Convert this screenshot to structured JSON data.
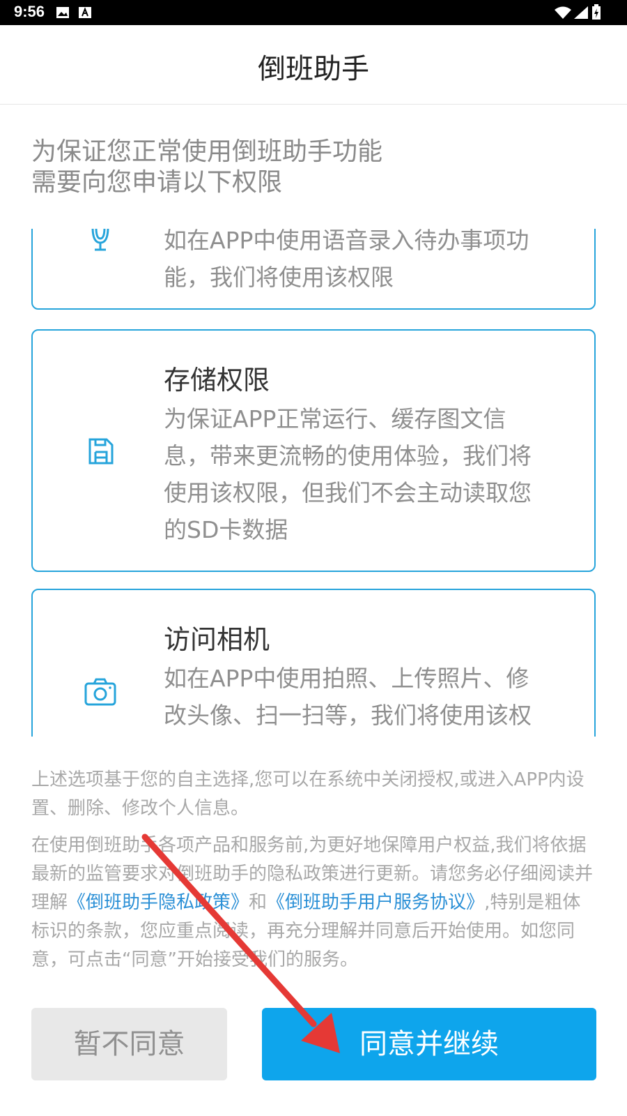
{
  "status_bar": {
    "time": "9:56"
  },
  "header": {
    "title": "倒班助手"
  },
  "intro": {
    "line1": "为保证您正常使用倒班助手功能",
    "line2": "需要向您申请以下权限"
  },
  "permissions": [
    {
      "icon": "microphone-icon",
      "title": "",
      "desc_line1": "如在APP中使用语音录入待办事项功",
      "desc_line2": "能，我们将使用该权限"
    },
    {
      "icon": "storage-icon",
      "title": "存储权限",
      "desc_line1": "为保证APP正常运行、缓存图文信",
      "desc_line2": "息，带来更流畅的使用体验，我们将",
      "desc_line3": "使用该权限，但我们不会主动读取您",
      "desc_line4": "的SD卡数据"
    },
    {
      "icon": "camera-icon",
      "title": "访问相机",
      "desc_line1": "如在APP中使用拍照、上传照片、修",
      "desc_line2": "改头像、扫一扫等，我们将使用该权"
    }
  ],
  "notice": {
    "para1": "上述选项基于您的自主选择,您可以在系统中关闭授权,或进入APP内设置、删除、修改个人信息。",
    "para2_before": "在使用倒班助手各项产品和服务前,为更好地保障用户权益,我们将依据最新的监管要求对倒班助手的隐私政策进行更新。请您务必仔细阅读并理解",
    "privacy_link": "《倒班助手隐私政策》",
    "and": "和",
    "service_link": "《倒班助手用户服务协议》",
    "para2_after": ",特别是粗体标识的条款，您应重点阅读，再充分理解并同意后开始使用。如您同意，可点击“同意”开始接受我们的服务。"
  },
  "buttons": {
    "decline": "暂不同意",
    "agree": "同意并继续"
  },
  "colors": {
    "accent": "#0ea5ec",
    "card_border": "#26a4db",
    "arrow": "#e53935"
  }
}
